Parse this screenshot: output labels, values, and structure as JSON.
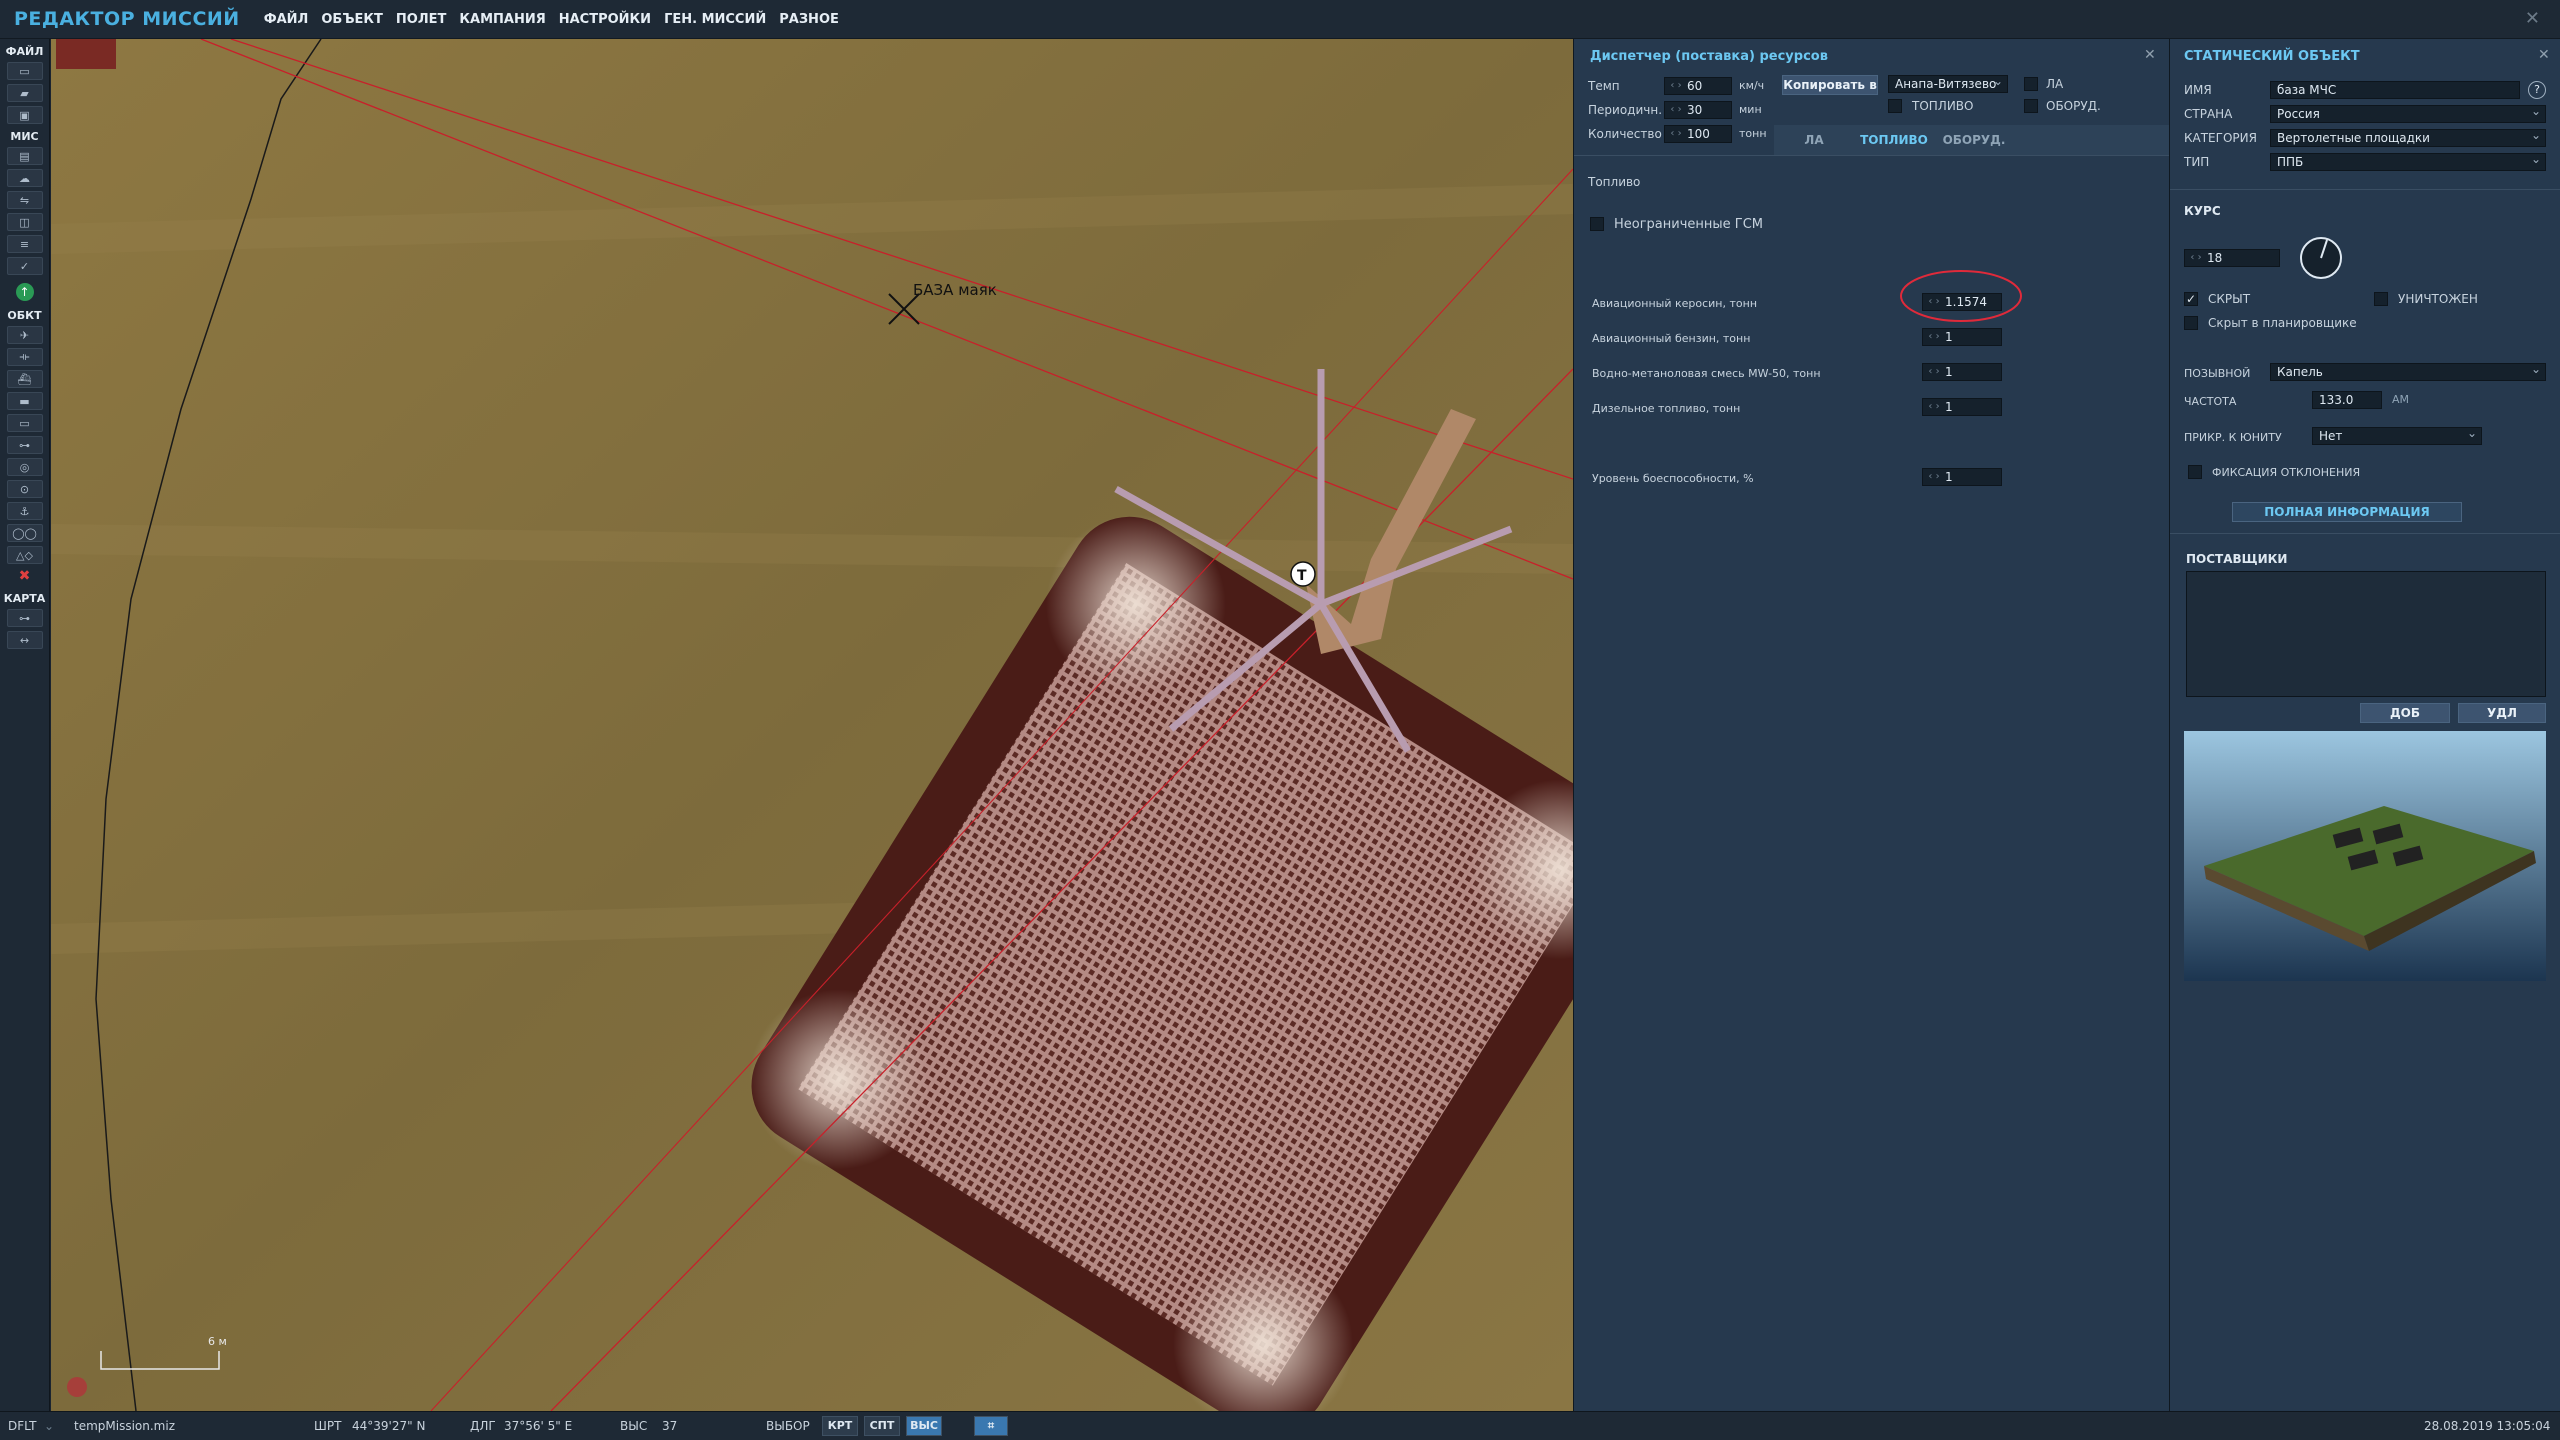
{
  "app": {
    "title": "РЕДАКТОР МИССИЙ"
  },
  "menu": [
    "ФАЙЛ",
    "ОБЪЕКТ",
    "ПОЛЕТ",
    "КАМПАНИЯ",
    "НАСТРОЙКИ",
    "ГЕН. МИССИЙ",
    "РАЗНОЕ"
  ],
  "toolbar": {
    "file_label": "ФАЙЛ",
    "mission_label": "МИС",
    "objects_label": "ОБКТ",
    "map_label": "КАРТА"
  },
  "map": {
    "marker_label": "БАЗА маяк",
    "scale_label": "6 м",
    "unit_marker": "T"
  },
  "resource_panel": {
    "title": "Диспетчер (поставка) ресурсов",
    "tempo_label": "Темп",
    "tempo_value": "60",
    "tempo_unit": "км/ч",
    "period_label": "Периодичн.",
    "period_value": "30",
    "period_unit": "мин",
    "quantity_label": "Количество",
    "quantity_value": "100",
    "quantity_unit": "тонн",
    "copy_button": "Копировать в",
    "copy_target": "Анапа-Витязево",
    "check_la": "ЛА",
    "check_fuel": "ТОПЛИВО",
    "check_equipment": "ОБОРУД.",
    "tabs": [
      "ЛА",
      "ТОПЛИВО",
      "ОБОРУД."
    ],
    "section_label": "Топливо",
    "unlimited_label": "Неограниченные ГСМ",
    "fuels": [
      {
        "label": "Авиационный керосин, тонн",
        "value": "1.1574"
      },
      {
        "label": "Авиационный бензин, тонн",
        "value": "1"
      },
      {
        "label": "Водно-метаноловая смесь MW-50, тонн",
        "value": "1"
      },
      {
        "label": "Дизельное топливо, тонн",
        "value": "1"
      }
    ],
    "readiness_label": "Уровень боеспособности, %",
    "readiness_value": "1"
  },
  "static_panel": {
    "title": "СТАТИЧЕСКИЙ ОБЪЕКТ",
    "name_label": "ИМЯ",
    "name_value": "база МЧС",
    "help_icon": "?",
    "country_label": "СТРАНА",
    "country_value": "Россия",
    "category_label": "КАТЕГОРИЯ",
    "category_value": "Вертолетные площадки",
    "type_label": "ТИП",
    "type_value": "ППБ",
    "heading_label": "КУРС",
    "heading_value": "18",
    "hidden_label": "СКРЫТ",
    "destroyed_label": "УНИЧТОЖЕН",
    "hidden_planner_label": "Скрыт в планировщике",
    "callsign_label": "ПОЗЫВНОЙ",
    "callsign_value": "Капель",
    "freq_label": "ЧАСТОТА",
    "freq_value": "133.0",
    "freq_mode": "AM",
    "link_label": "ПРИКР. К ЮНИТУ",
    "link_value": "Нет",
    "deviation_label": "ФИКСАЦИЯ ОТКЛОНЕНИЯ",
    "full_info_button": "ПОЛНАЯ ИНФОРМАЦИЯ",
    "suppliers_label": "ПОСТАВЩИКИ",
    "add_button": "ДОБ",
    "delete_button": "УДЛ"
  },
  "status": {
    "profile": "DFLT",
    "file": "tempMission.miz",
    "lat_label": "ШРТ",
    "lat_value": "44°39'27\" N",
    "lon_label": "ДЛГ",
    "lon_value": "37°56' 5\" E",
    "alt_label": "ВЫС",
    "alt_value": "37",
    "select_label": "ВЫБОР",
    "btn_krt": "КРТ",
    "btn_spt": "СПТ",
    "btn_vys": "ВЫС",
    "datetime": "28.08.2019 13:05:04"
  },
  "colors": {
    "accent": "#6cc8f2",
    "title": "#4ab0e0",
    "panel": "#26394e",
    "annotation": "#e02a3a"
  }
}
